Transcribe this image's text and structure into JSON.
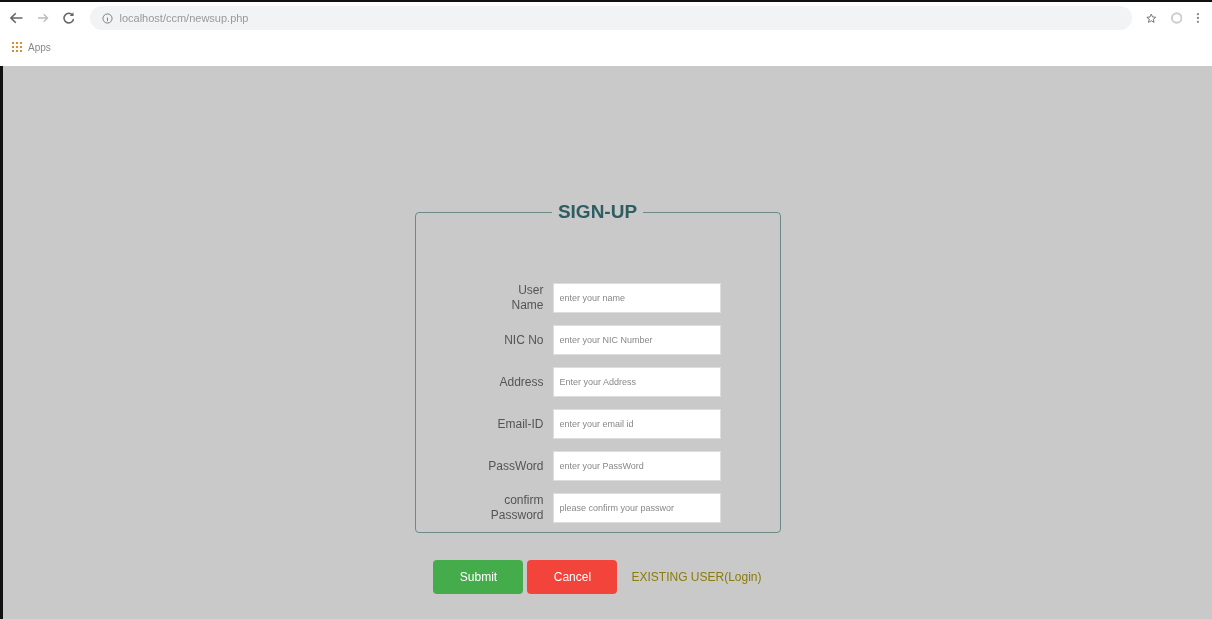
{
  "browser": {
    "url": "localhost/ccm/newsup.php",
    "bookmarks": [
      {
        "label": "Apps"
      }
    ]
  },
  "form": {
    "title": "SIGN-UP",
    "fields": [
      {
        "label": "User Name",
        "placeholder": "enter your name"
      },
      {
        "label": "NIC No",
        "placeholder": "enter your NIC Number"
      },
      {
        "label": "Address",
        "placeholder": "Enter your Address"
      },
      {
        "label": "Email-ID",
        "placeholder": "enter your email id"
      },
      {
        "label": "PassWord",
        "placeholder": "enter your PassWord"
      },
      {
        "label": "confirm Password",
        "placeholder": "please confirm your passwor"
      }
    ]
  },
  "buttons": [
    {
      "label": "Submit",
      "kind": "submit"
    },
    {
      "label": "Cancel",
      "kind": "cancel"
    }
  ],
  "login_link": "EXISTING USER(Login)"
}
